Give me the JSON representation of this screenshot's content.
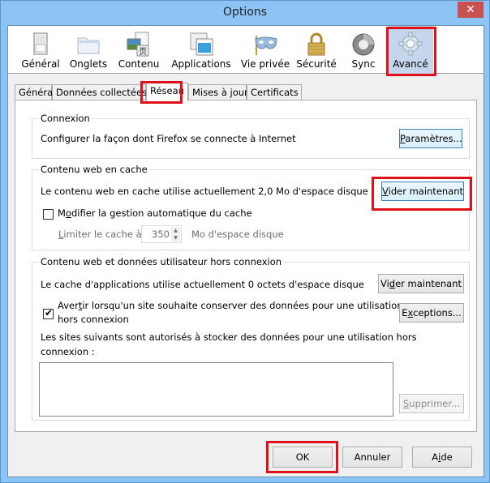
{
  "window": {
    "title": "Options",
    "close_glyph": "✕"
  },
  "toolbar": {
    "panes": [
      {
        "label": "Général",
        "icon": "general-switch-icon"
      },
      {
        "label": "Onglets",
        "icon": "folder-tabs-icon"
      },
      {
        "label": "Contenu",
        "icon": "content-page-icon"
      },
      {
        "label": "Applications",
        "icon": "applications-icon"
      },
      {
        "label": "Vie privée",
        "icon": "privacy-mask-icon"
      },
      {
        "label": "Sécurité",
        "icon": "padlock-icon"
      },
      {
        "label": "Sync",
        "icon": "sync-icon"
      },
      {
        "label": "Avancé",
        "icon": "gear-icon",
        "selected": true
      }
    ]
  },
  "tabs": [
    {
      "label": "Général"
    },
    {
      "label": "Données collectées"
    },
    {
      "label": "Réseau",
      "active": true
    },
    {
      "label": "Mises à jour"
    },
    {
      "label": "Certificats"
    }
  ],
  "connexion": {
    "legend": "Connexion",
    "description": "Configurer la façon dont Firefox se connecte à Internet",
    "settings_button": {
      "mnemonic": "P",
      "rest": "aramètres..."
    }
  },
  "cache": {
    "legend": "Contenu web en cache",
    "usage_text": "Le contenu web en cache utilise actuellement 2,0 Mo d'espace disque",
    "clear_button": {
      "mnemonic": "V",
      "rest": "ider maintenant"
    },
    "override_checkbox": {
      "pre": "M",
      "mnemonic": "o",
      "rest": "difier la gestion automatique du cache",
      "checked": false
    },
    "limit_label": {
      "mnemonic": "L",
      "rest": "imiter le cache à"
    },
    "limit_value": "350",
    "limit_unit": "Mo d'espace disque"
  },
  "offline": {
    "legend": "Contenu web et données utilisateur hors connexion",
    "usage_text": "Le cache d'applications utilise actuellement 0 octets d'espace disque",
    "clear_button": {
      "pre": "Vi",
      "mnemonic": "d",
      "rest": "er maintenant"
    },
    "warn_checkbox": {
      "pre": "Aver",
      "mnemonic": "t",
      "rest_line1": "ir lorsqu'un site souhaite conserver des données pour une utilisation",
      "line2": "hors connexion",
      "checked": true
    },
    "exceptions_button": {
      "pre": "E",
      "mnemonic": "x",
      "rest": "ceptions..."
    },
    "allowed_label_line1": "Les sites suivants sont autorisés à stocker des données pour une utilisation hors",
    "allowed_label_line2": "connexion :",
    "allowed_sites": [],
    "remove_button": {
      "mnemonic": "S",
      "rest": "upprimer...",
      "disabled": true
    }
  },
  "footer": {
    "ok_label": "OK",
    "cancel_label": "Annuler",
    "help_button": {
      "pre": "A",
      "mnemonic": "i",
      "rest": "de"
    }
  },
  "colors": {
    "window_frame": "#8cc4f5",
    "close_button": "#c75050",
    "selected_pane": "#c4d5ec",
    "highlight": "#e0101a"
  }
}
